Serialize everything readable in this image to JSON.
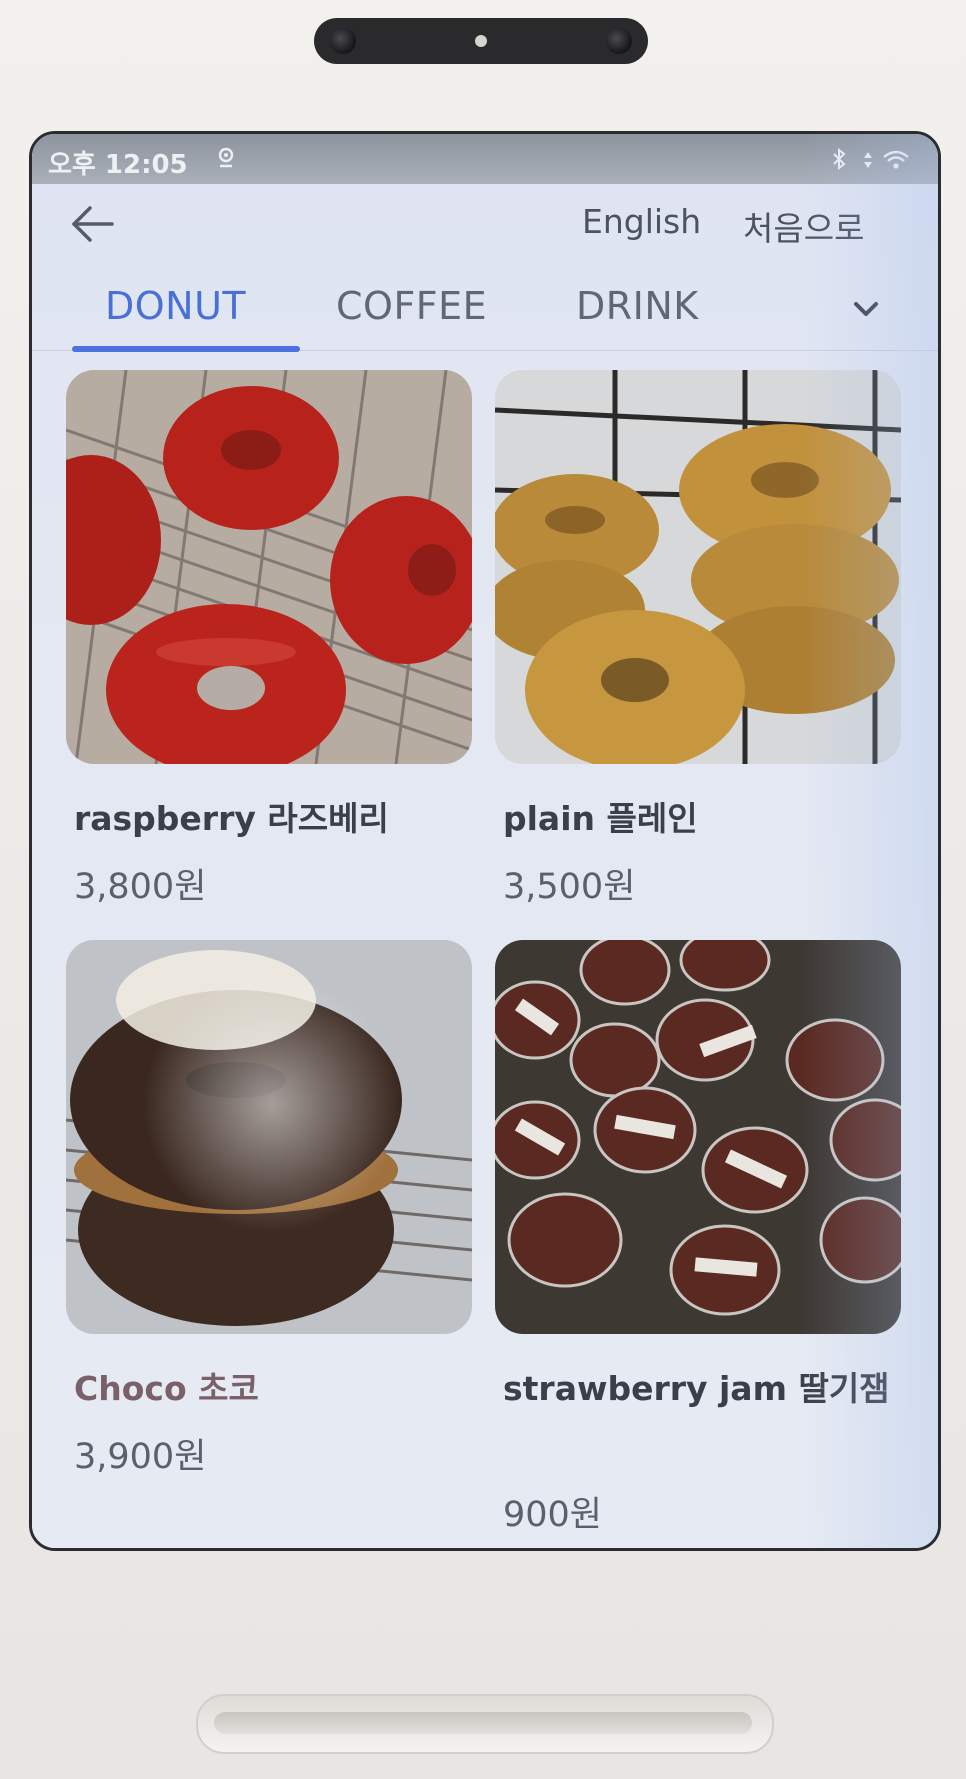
{
  "status_bar": {
    "time": "오후 12:05",
    "location_icon": "location-pin-icon",
    "right_icons": [
      "bluetooth-icon",
      "data-arrows-icon",
      "wifi-icon"
    ]
  },
  "header": {
    "back_icon": "back-arrow-icon",
    "language_label": "English",
    "home_label": "처음으로"
  },
  "tabs": {
    "items": [
      {
        "label": "DONUT",
        "active": true
      },
      {
        "label": "COFFEE",
        "active": false
      },
      {
        "label": "DRINK",
        "active": false
      }
    ],
    "more_icon": "chevron-down-icon",
    "accent_color": "#4a6fd6"
  },
  "products": [
    {
      "name": "raspberry 라즈베리",
      "price": "3,800원",
      "image": "raspberry-glazed-donuts"
    },
    {
      "name": "plain 플레인",
      "price": "3,500원",
      "image": "plain-donuts"
    },
    {
      "name": "Choco 초코",
      "price": "3,900원",
      "image": "chocolate-donuts"
    },
    {
      "name": "strawberry jam 딸기잼",
      "price": "900원",
      "image": "strawberry-jam-cups"
    }
  ]
}
